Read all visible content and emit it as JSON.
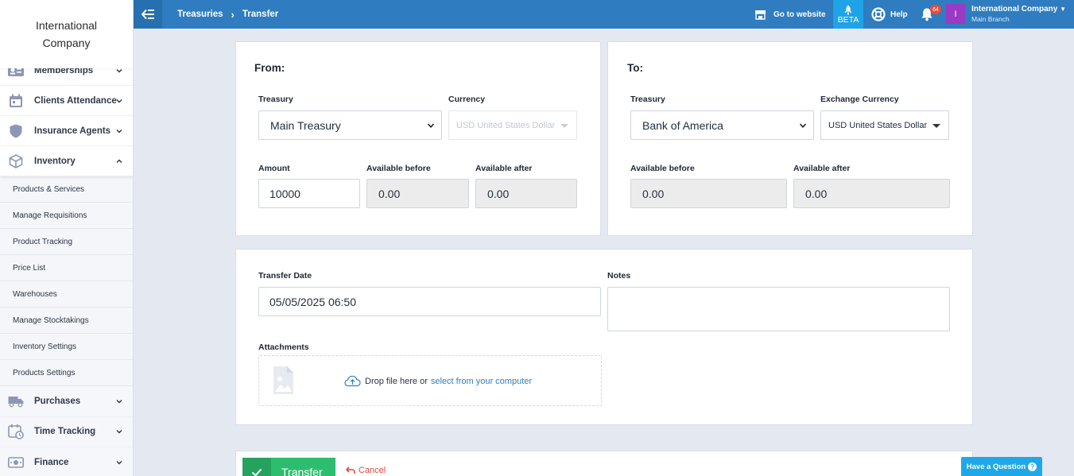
{
  "sidebar": {
    "brand": "International Company",
    "items": [
      {
        "label": "Memberships",
        "icon": "id-card-icon"
      },
      {
        "label": "Clients Attendance",
        "icon": "calendar-icon"
      },
      {
        "label": "Insurance Agents",
        "icon": "shield-icon"
      },
      {
        "label": "Inventory",
        "icon": "box-icon"
      }
    ],
    "submenu": [
      "Products & Services",
      "Manage Requisitions",
      "Product Tracking",
      "Price List",
      "Warehouses",
      "Manage Stocktakings",
      "Inventory Settings",
      "Products Settings"
    ],
    "items_after": [
      {
        "label": "Purchases",
        "icon": "truck-icon"
      },
      {
        "label": "Time Tracking",
        "icon": "clock-calendar-icon"
      },
      {
        "label": "Finance",
        "icon": "money-icon"
      }
    ]
  },
  "topbar": {
    "breadcrumb": [
      "Treasuries",
      "Transfer"
    ],
    "go_to_website": "Go to website",
    "beta": "BETA",
    "help": "Help",
    "notification_count": "64",
    "user_initial": "I",
    "user_name": "International Company",
    "user_branch": "Main Branch",
    "color": "#2f7cc0"
  },
  "from": {
    "title": "From:",
    "treasury_label": "Treasury",
    "treasury_value": "Main Treasury",
    "currency_label": "Currency",
    "currency_value": "USD United States Dollar",
    "amount_label": "Amount",
    "amount_value": "10000",
    "available_before_label": "Available before",
    "available_before_value": "0.00",
    "available_after_label": "Available after",
    "available_after_value": "0.00"
  },
  "to": {
    "title": "To:",
    "treasury_label": "Treasury",
    "treasury_value": "Bank of America",
    "exchange_currency_label": "Exchange Currency",
    "exchange_currency_value": "USD United States Dollar",
    "available_before_label": "Available before",
    "available_before_value": "0.00",
    "available_after_label": "Available after",
    "available_after_value": "0.00"
  },
  "details": {
    "transfer_date_label": "Transfer Date",
    "transfer_date_value": "05/05/2025 06:50",
    "notes_label": "Notes",
    "notes_value": "",
    "attachments_label": "Attachments",
    "drop_text": "Drop file here or",
    "select_link": "select from your computer"
  },
  "actions": {
    "transfer": "Transfer",
    "cancel": "Cancel",
    "question": "Have a Question",
    "primary_color": "#2dbd6e"
  }
}
